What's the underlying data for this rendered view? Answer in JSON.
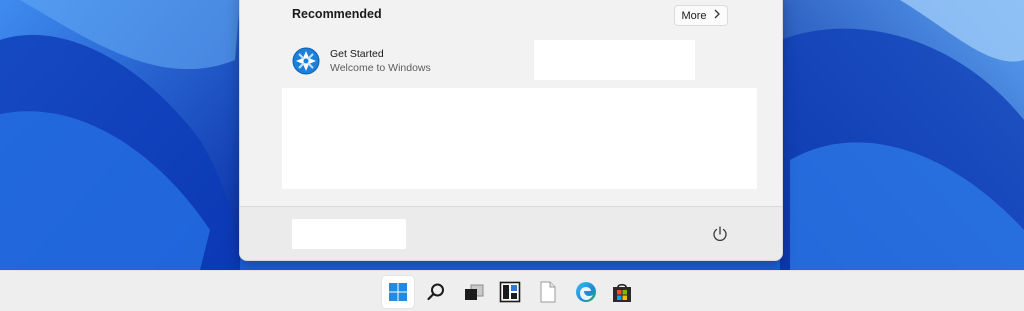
{
  "start_menu": {
    "recommended_title": "Recommended",
    "more_button": {
      "label": "More",
      "icon": "chevron-right-icon"
    },
    "recommended_items": [
      {
        "title": "Get Started",
        "subtitle": "Welcome to Windows",
        "icon": "get-started-icon"
      }
    ],
    "footer": {
      "power_icon": "power-icon"
    }
  },
  "taskbar": {
    "icons": [
      "start-icon",
      "search-icon",
      "task-view-icon",
      "widgets-icon",
      "file-explorer-icon",
      "edge-icon",
      "store-icon"
    ]
  },
  "colors": {
    "accent": "#0067c0",
    "wallpaper_deep": "#0a3dbf",
    "wallpaper_light": "#a7cdf5"
  }
}
